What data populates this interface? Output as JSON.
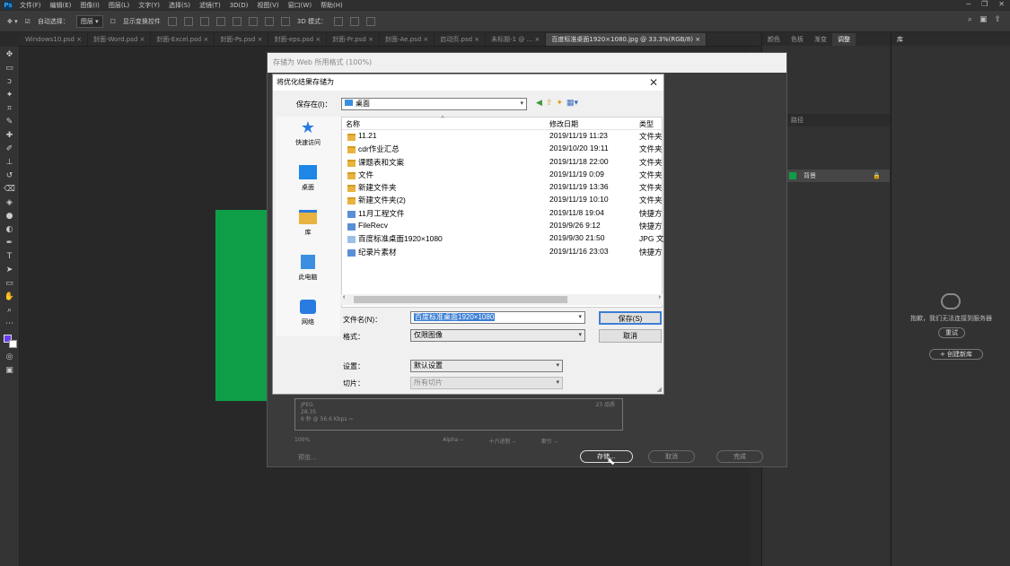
{
  "menu": {
    "items": [
      "文件(F)",
      "编辑(E)",
      "图像(I)",
      "图层(L)",
      "文字(Y)",
      "选择(S)",
      "滤镜(T)",
      "3D(D)",
      "视图(V)",
      "窗口(W)",
      "帮助(H)"
    ]
  },
  "options_bar": {
    "auto_select_label": "自动选择：",
    "auto_select_value": "图层",
    "transform_label": "显示变换控件",
    "mode_3d_label": "3D 模式："
  },
  "doc_tabs": [
    {
      "label": "Windows10.psd"
    },
    {
      "label": "封面-Word.psd"
    },
    {
      "label": "封面-Excel.psd"
    },
    {
      "label": "封面-Ps.psd"
    },
    {
      "label": "封面-eps.psd"
    },
    {
      "label": "封面-Pr.psd"
    },
    {
      "label": "封面-Ae.psd"
    },
    {
      "label": "启动页.psd"
    },
    {
      "label": "未标题-1 @ ..."
    },
    {
      "label": "百度标准桌面1920×1080.jpg @ 33.3%(RGB/8)"
    }
  ],
  "right_panel": {
    "tabs": [
      "颜色",
      "色板",
      "渐变",
      "调整"
    ],
    "layer_tabs": [
      "通道",
      "路径"
    ],
    "layer_name": "背景"
  },
  "library_panel": {
    "tab": "库",
    "message": "抱歉，我们无法连接到服务器",
    "retry": "重试",
    "create": "+ 创建新库"
  },
  "sfw_dialog": {
    "title": "存储为 Web 所用格式 (100%)",
    "preview": "预览...",
    "save": "存储...",
    "cancel": "取消",
    "done": "完成",
    "zoom": "100%",
    "alpha": "Alpha --",
    "hex": "十六进制 --",
    "index": "索引 --",
    "info_lines": [
      "JPEG",
      "28.35",
      "6 秒 @ 56.6 Kbps ⇨"
    ],
    "quality_note": "23 品质"
  },
  "save_dialog": {
    "title": "将优化结果存储为",
    "save_in_label": "保存在(I)：",
    "save_in_value": "桌面",
    "places": [
      {
        "label": "快速访问",
        "icon": "star-icon"
      },
      {
        "label": "桌面",
        "icon": "desktop-icon"
      },
      {
        "label": "库",
        "icon": "library-icon"
      },
      {
        "label": "此电脑",
        "icon": "computer-icon"
      },
      {
        "label": "网络",
        "icon": "network-icon"
      }
    ],
    "columns": {
      "name": "名称",
      "date": "修改日期",
      "type": "类型"
    },
    "files": [
      {
        "name": "11.21",
        "date": "2019/11/19 11:23",
        "type": "文件夹",
        "icon": "folder"
      },
      {
        "name": "cdr作业汇总",
        "date": "2019/10/20 19:11",
        "type": "文件夹",
        "icon": "folder"
      },
      {
        "name": "课题表和文案",
        "date": "2019/11/18 22:00",
        "type": "文件夹",
        "icon": "folder"
      },
      {
        "name": "文件",
        "date": "2019/11/19 0:09",
        "type": "文件夹",
        "icon": "folder"
      },
      {
        "name": "新建文件夹",
        "date": "2019/11/19 13:36",
        "type": "文件夹",
        "icon": "folder"
      },
      {
        "name": "新建文件夹(2)",
        "date": "2019/11/19 10:10",
        "type": "文件夹",
        "icon": "folder"
      },
      {
        "name": "11月工程文件",
        "date": "2019/11/8 19:04",
        "type": "快捷方",
        "icon": "shortcut"
      },
      {
        "name": "FileRecv",
        "date": "2019/9/26 9:12",
        "type": "快捷方",
        "icon": "shortcut"
      },
      {
        "name": "百度标准桌面1920×1080",
        "date": "2019/9/30 21:50",
        "type": "JPG 文",
        "icon": "file"
      },
      {
        "name": "纪录片素材",
        "date": "2019/11/16 23:03",
        "type": "快捷方",
        "icon": "shortcut"
      }
    ],
    "filename_label": "文件名(N)：",
    "filename_value": "百度标准桌面1920×1080",
    "format_label": "格式：",
    "format_value": "仅限图像",
    "settings_label": "设置：",
    "settings_value": "默认设置",
    "slices_label": "切片：",
    "slices_value": "所有切片",
    "save_button": "保存(S)",
    "cancel_button": "取消"
  }
}
